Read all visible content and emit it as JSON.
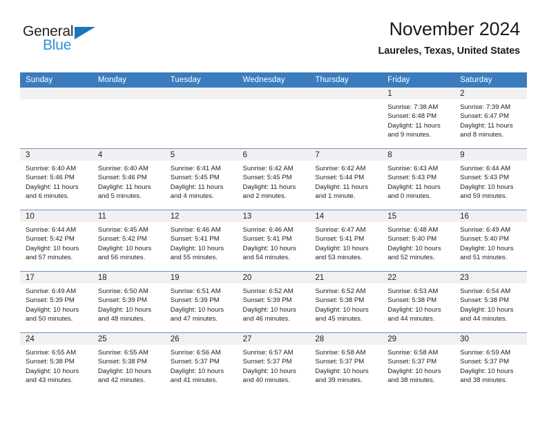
{
  "brand": {
    "name_part1": "General",
    "name_part2": "Blue",
    "accent_color": "#1b75bb",
    "logo_blue_text_color": "#2b8fd4"
  },
  "header": {
    "title": "November 2024",
    "subtitle": "Laureles, Texas, United States",
    "header_bg_color": "#3a7cbe",
    "daynum_strip_color": "#f1f1f1"
  },
  "weekday_headers": [
    "Sunday",
    "Monday",
    "Tuesday",
    "Wednesday",
    "Thursday",
    "Friday",
    "Saturday"
  ],
  "labels": {
    "sunrise_prefix": "Sunrise:",
    "sunset_prefix": "Sunset:",
    "daylight_prefix": "Daylight:"
  },
  "weeks": [
    [
      {
        "day": "",
        "empty": true
      },
      {
        "day": "",
        "empty": true
      },
      {
        "day": "",
        "empty": true
      },
      {
        "day": "",
        "empty": true
      },
      {
        "day": "",
        "empty": true
      },
      {
        "day": "1",
        "sunrise": "Sunrise: 7:38 AM",
        "sunset": "Sunset: 6:48 PM",
        "daylight": "Daylight: 11 hours and 9 minutes."
      },
      {
        "day": "2",
        "sunrise": "Sunrise: 7:39 AM",
        "sunset": "Sunset: 6:47 PM",
        "daylight": "Daylight: 11 hours and 8 minutes."
      }
    ],
    [
      {
        "day": "3",
        "sunrise": "Sunrise: 6:40 AM",
        "sunset": "Sunset: 5:46 PM",
        "daylight": "Daylight: 11 hours and 6 minutes."
      },
      {
        "day": "4",
        "sunrise": "Sunrise: 6:40 AM",
        "sunset": "Sunset: 5:46 PM",
        "daylight": "Daylight: 11 hours and 5 minutes."
      },
      {
        "day": "5",
        "sunrise": "Sunrise: 6:41 AM",
        "sunset": "Sunset: 5:45 PM",
        "daylight": "Daylight: 11 hours and 4 minutes."
      },
      {
        "day": "6",
        "sunrise": "Sunrise: 6:42 AM",
        "sunset": "Sunset: 5:45 PM",
        "daylight": "Daylight: 11 hours and 2 minutes."
      },
      {
        "day": "7",
        "sunrise": "Sunrise: 6:42 AM",
        "sunset": "Sunset: 5:44 PM",
        "daylight": "Daylight: 11 hours and 1 minute."
      },
      {
        "day": "8",
        "sunrise": "Sunrise: 6:43 AM",
        "sunset": "Sunset: 5:43 PM",
        "daylight": "Daylight: 11 hours and 0 minutes."
      },
      {
        "day": "9",
        "sunrise": "Sunrise: 6:44 AM",
        "sunset": "Sunset: 5:43 PM",
        "daylight": "Daylight: 10 hours and 59 minutes."
      }
    ],
    [
      {
        "day": "10",
        "sunrise": "Sunrise: 6:44 AM",
        "sunset": "Sunset: 5:42 PM",
        "daylight": "Daylight: 10 hours and 57 minutes."
      },
      {
        "day": "11",
        "sunrise": "Sunrise: 6:45 AM",
        "sunset": "Sunset: 5:42 PM",
        "daylight": "Daylight: 10 hours and 56 minutes."
      },
      {
        "day": "12",
        "sunrise": "Sunrise: 6:46 AM",
        "sunset": "Sunset: 5:41 PM",
        "daylight": "Daylight: 10 hours and 55 minutes."
      },
      {
        "day": "13",
        "sunrise": "Sunrise: 6:46 AM",
        "sunset": "Sunset: 5:41 PM",
        "daylight": "Daylight: 10 hours and 54 minutes."
      },
      {
        "day": "14",
        "sunrise": "Sunrise: 6:47 AM",
        "sunset": "Sunset: 5:41 PM",
        "daylight": "Daylight: 10 hours and 53 minutes."
      },
      {
        "day": "15",
        "sunrise": "Sunrise: 6:48 AM",
        "sunset": "Sunset: 5:40 PM",
        "daylight": "Daylight: 10 hours and 52 minutes."
      },
      {
        "day": "16",
        "sunrise": "Sunrise: 6:49 AM",
        "sunset": "Sunset: 5:40 PM",
        "daylight": "Daylight: 10 hours and 51 minutes."
      }
    ],
    [
      {
        "day": "17",
        "sunrise": "Sunrise: 6:49 AM",
        "sunset": "Sunset: 5:39 PM",
        "daylight": "Daylight: 10 hours and 50 minutes."
      },
      {
        "day": "18",
        "sunrise": "Sunrise: 6:50 AM",
        "sunset": "Sunset: 5:39 PM",
        "daylight": "Daylight: 10 hours and 48 minutes."
      },
      {
        "day": "19",
        "sunrise": "Sunrise: 6:51 AM",
        "sunset": "Sunset: 5:39 PM",
        "daylight": "Daylight: 10 hours and 47 minutes."
      },
      {
        "day": "20",
        "sunrise": "Sunrise: 6:52 AM",
        "sunset": "Sunset: 5:39 PM",
        "daylight": "Daylight: 10 hours and 46 minutes."
      },
      {
        "day": "21",
        "sunrise": "Sunrise: 6:52 AM",
        "sunset": "Sunset: 5:38 PM",
        "daylight": "Daylight: 10 hours and 45 minutes."
      },
      {
        "day": "22",
        "sunrise": "Sunrise: 6:53 AM",
        "sunset": "Sunset: 5:38 PM",
        "daylight": "Daylight: 10 hours and 44 minutes."
      },
      {
        "day": "23",
        "sunrise": "Sunrise: 6:54 AM",
        "sunset": "Sunset: 5:38 PM",
        "daylight": "Daylight: 10 hours and 44 minutes."
      }
    ],
    [
      {
        "day": "24",
        "sunrise": "Sunrise: 6:55 AM",
        "sunset": "Sunset: 5:38 PM",
        "daylight": "Daylight: 10 hours and 43 minutes."
      },
      {
        "day": "25",
        "sunrise": "Sunrise: 6:55 AM",
        "sunset": "Sunset: 5:38 PM",
        "daylight": "Daylight: 10 hours and 42 minutes."
      },
      {
        "day": "26",
        "sunrise": "Sunrise: 6:56 AM",
        "sunset": "Sunset: 5:37 PM",
        "daylight": "Daylight: 10 hours and 41 minutes."
      },
      {
        "day": "27",
        "sunrise": "Sunrise: 6:57 AM",
        "sunset": "Sunset: 5:37 PM",
        "daylight": "Daylight: 10 hours and 40 minutes."
      },
      {
        "day": "28",
        "sunrise": "Sunrise: 6:58 AM",
        "sunset": "Sunset: 5:37 PM",
        "daylight": "Daylight: 10 hours and 39 minutes."
      },
      {
        "day": "29",
        "sunrise": "Sunrise: 6:58 AM",
        "sunset": "Sunset: 5:37 PM",
        "daylight": "Daylight: 10 hours and 38 minutes."
      },
      {
        "day": "30",
        "sunrise": "Sunrise: 6:59 AM",
        "sunset": "Sunset: 5:37 PM",
        "daylight": "Daylight: 10 hours and 38 minutes."
      }
    ]
  ]
}
